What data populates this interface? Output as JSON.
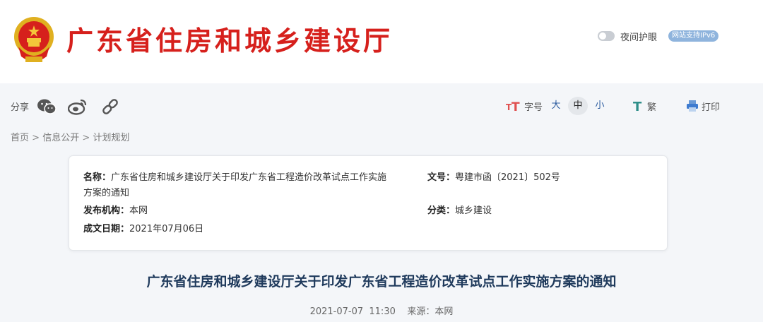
{
  "header": {
    "site_title": "广东省住房和城乡建设厅",
    "night_mode_label": "夜间护眼",
    "ipv6_badge": "网站支持IPv6"
  },
  "toolbar": {
    "share_label": "分享",
    "font_size_label": "字号",
    "size_large": "大",
    "size_medium": "中",
    "size_small": "小",
    "traditional_label": "繁",
    "print_label": "打印"
  },
  "breadcrumb": {
    "items": [
      "首页",
      "信息公开",
      "计划规划"
    ],
    "separator": ">"
  },
  "info": {
    "name_label": "名称：",
    "name_value_line1": "广东省住房和城乡建设厅关于印发广东省工程造价改革试点工作实施",
    "name_value_line2": "方案的通知",
    "doc_no_label": "文号：",
    "doc_no_value": "粤建市函〔2021〕502号",
    "publisher_label": "发布机构：",
    "publisher_value": "本网",
    "category_label": "分类：",
    "category_value": "城乡建设",
    "date_label": "成文日期：",
    "date_value": "2021年07月06日"
  },
  "article": {
    "title": "广东省住房和城乡建设厅关于印发广东省工程造价改革试点工作实施方案的通知",
    "date": "2021-07-07",
    "time": "11:30",
    "source_label": "来源：",
    "source_value": "本网"
  },
  "colors": {
    "title_red": "#d6201c",
    "link_blue": "#2a5a9e",
    "article_title": "#1f3a5c"
  }
}
